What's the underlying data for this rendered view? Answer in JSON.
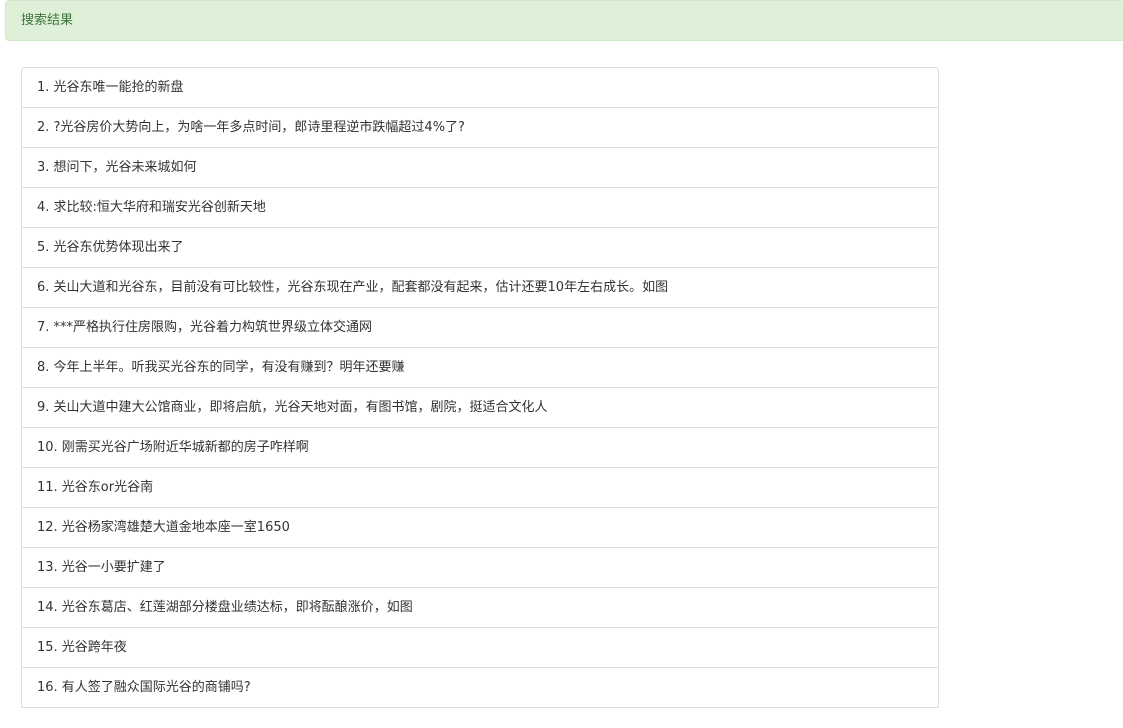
{
  "header": {
    "title": "搜索结果"
  },
  "results": [
    "1. 光谷东唯一能抢的新盘",
    "2. ?光谷房价大势向上，为啥一年多点时间，郎诗里程逆市跌幅超过4%了?",
    "3. 想问下，光谷未来城如何",
    "4. 求比较:恒大华府和瑞安光谷创新天地",
    "5. 光谷东优势体现出来了",
    "6. 关山大道和光谷东，目前没有可比较性，光谷东现在产业，配套都没有起来，估计还要10年左右成长。如图",
    "7. ***严格执行住房限购，光谷着力构筑世界级立体交通网",
    "8. 今年上半年。听我买光谷东的同学，有没有赚到？明年还要赚",
    "9. 关山大道中建大公馆商业，即将启航，光谷天地对面，有图书馆，剧院，挺适合文化人",
    "10. 刚需买光谷广场附近华城新都的房子咋样啊",
    "11. 光谷东or光谷南",
    "12. 光谷杨家湾雄楚大道金地本座一室1650",
    "13. 光谷一小要扩建了",
    "14. 光谷东葛店、红莲湖部分楼盘业绩达标，即将酝酿涨价，如图",
    "15. 光谷跨年夜",
    "16. 有人签了融众国际光谷的商铺吗?"
  ]
}
